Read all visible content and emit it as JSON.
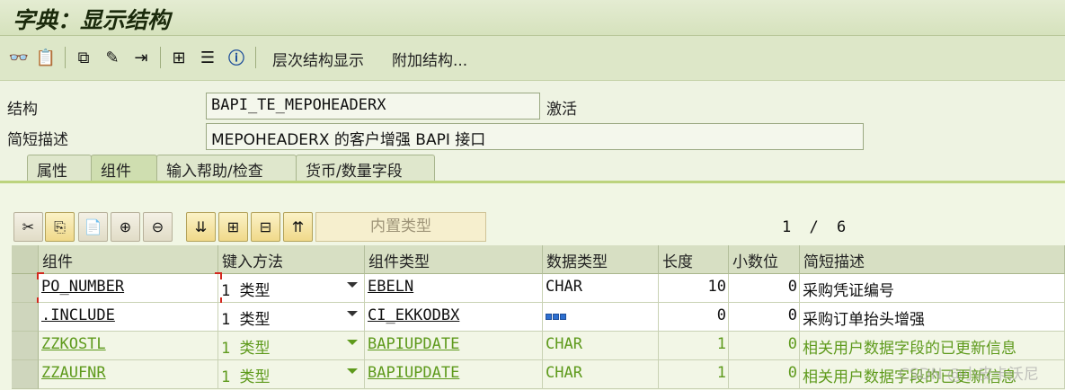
{
  "window": {
    "title": "字典：显示结构"
  },
  "toolbar": {
    "icons": [
      "glasses-icon",
      "clipboard-icon",
      "hierarchy-icon",
      "magic-wand-icon",
      "export-icon",
      "tree-icon",
      "list-icon",
      "info-icon"
    ],
    "hierarchy_display": "层次结构显示",
    "append_structure": "附加结构..."
  },
  "header": {
    "structure_label": "结构",
    "structure_value": "BAPI_TE_MEPOHEADERX",
    "status": "激活",
    "short_desc_label": "简短描述",
    "short_desc_value": "MEPOHEADERX 的客户增强 BAPI 接口"
  },
  "tabs": [
    {
      "label": "属性"
    },
    {
      "label": "组件",
      "active": true
    },
    {
      "label": "输入帮助/检查"
    },
    {
      "label": "货币/数量字段"
    }
  ],
  "component_toolbar": {
    "builtin_type": "内置类型",
    "page_current": "1",
    "page_sep": "/",
    "page_total": "6"
  },
  "table": {
    "columns": [
      "组件",
      "键入方法",
      "组件类型",
      "数据类型",
      "长度",
      "小数位",
      "简短描述"
    ],
    "rows": [
      {
        "component": "PO_NUMBER",
        "typing": "1 类型",
        "comp_type": "EBELN",
        "data_type": "CHAR",
        "length": "10",
        "decimals": "0",
        "desc": "采购凭证编号",
        "style": "white"
      },
      {
        "component": ".INCLUDE",
        "typing": "1 类型",
        "comp_type": "CI_EKKODBX",
        "data_type": "",
        "length": "0",
        "decimals": "0",
        "desc": "采购订单抬头增强",
        "style": "white",
        "data_type_icon": "structure-icon"
      },
      {
        "component": "ZZKOSTL",
        "typing": "1 类型",
        "comp_type": "BAPIUPDATE",
        "data_type": "CHAR",
        "length": "1",
        "decimals": "0",
        "desc": "相关用户数据字段的已更新信息",
        "style": "green"
      },
      {
        "component": "ZZAUFNR",
        "typing": "1 类型",
        "comp_type": "BAPIUPDATE",
        "data_type": "CHAR",
        "length": "1",
        "decimals": "0",
        "desc": "相关用户数据字段的已更新信息",
        "style": "green"
      }
    ]
  },
  "watermark": "CSDN @小皮卡沃尼",
  "colors": {
    "accent_green": "#5e9a1c",
    "tab_line": "#bcd37d",
    "focus_red": "#d2281e"
  }
}
